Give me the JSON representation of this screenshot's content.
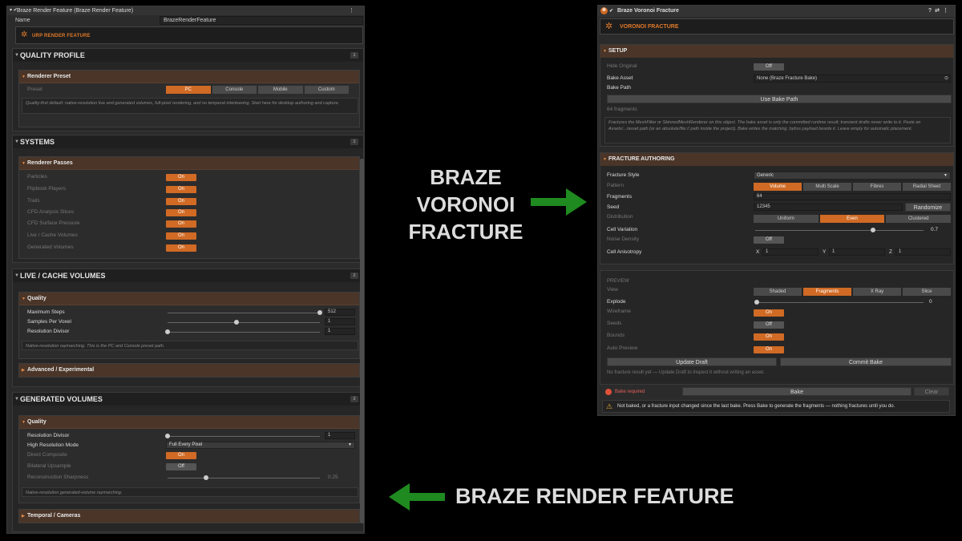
{
  "render_feature": {
    "title": "Braze Render Feature (Braze Render Feature)",
    "name_label": "Name",
    "name_value": "BrazeRenderFeature",
    "banner": "URP RENDER FEATURE",
    "quality_profile": {
      "title": "QUALITY PROFILE",
      "badge": "1",
      "renderer_preset": {
        "title": "Renderer Preset",
        "preset_label": "Preset",
        "options": [
          "PC",
          "Console",
          "Mobile",
          "Custom"
        ],
        "selected": "PC",
        "note": "Quality-first default: native-resolution live and generated volumes, full-pixel rendering, and no temporal interleaving. Start here for desktop authoring and capture."
      }
    },
    "systems": {
      "title": "SYSTEMS",
      "badge": "1",
      "renderer_passes": {
        "title": "Renderer Passes",
        "passes": [
          {
            "label": "Particles",
            "state": "On"
          },
          {
            "label": "Flipbook Players",
            "state": "On"
          },
          {
            "label": "Trails",
            "state": "On"
          },
          {
            "label": "CFD Analysis Slices",
            "state": "On"
          },
          {
            "label": "CFD Surface Pressure",
            "state": "On"
          },
          {
            "label": "Live / Cache Volumes",
            "state": "On"
          },
          {
            "label": "Generated Volumes",
            "state": "On"
          }
        ]
      }
    },
    "live_cache": {
      "title": "LIVE / CACHE VOLUMES",
      "badge": "2",
      "quality_title": "Quality",
      "max_steps_label": "Maximum Steps",
      "max_steps_value": "512",
      "max_steps_fraction": 1.0,
      "samples_label": "Samples Per Voxel",
      "samples_value": "1",
      "samples_fraction": 0.45,
      "res_div_label": "Resolution Divisor",
      "res_div_value": "1",
      "res_div_fraction": 0.0,
      "note": "Native-resolution raymarching. This is the PC and Console preset path.",
      "advanced_title": "Advanced / Experimental"
    },
    "generated": {
      "title": "GENERATED VOLUMES",
      "badge": "2",
      "quality_title": "Quality",
      "res_div_label": "Resolution Divisor",
      "res_div_value": "1",
      "res_div_fraction": 0.0,
      "high_res_label": "High Resolution Mode",
      "high_res_value": "Full Every Pixel",
      "direct_label": "Direct Composite",
      "direct_state": "On",
      "bilateral_label": "Bilateral Upsample",
      "bilateral_state": "Off",
      "sharpness_label": "Reconstruction Sharpness",
      "sharpness_value": "0.25",
      "sharpness_fraction": 0.25,
      "note": "Native-resolution generated-volume raymarching.",
      "temporal_title": "Temporal / Cameras"
    }
  },
  "voronoi": {
    "title": "Braze Voronoi Fracture",
    "banner": "VORONOI FRACTURE",
    "setup": {
      "title": "SETUP",
      "hide_original_label": "Hide Original",
      "hide_original_state": "Off",
      "bake_asset_label": "Bake Asset",
      "bake_asset_value": "None (Braze Fracture Bake)",
      "bake_path_label": "Bake Path",
      "use_bake_path": "Use Bake Path",
      "fragments_info": "64 fragments",
      "note": "Fractures the MeshFilter or SkinnedMeshRenderer on this object. The bake asset is only the committed runtime result; transient drafts never write to it. Paste an Assets/.../asset path (or an absolute/file:// path inside the project). Bake writes the matching .bybss payload beside it. Leave empty for automatic placement."
    },
    "authoring": {
      "title": "FRACTURE AUTHORING",
      "style_label": "Fracture Style",
      "style_value": "Generic",
      "pattern_label": "Pattern",
      "pattern_options": [
        "Volume",
        "Multi Scale",
        "Fibres",
        "Radial Sheet"
      ],
      "pattern_selected": "Volume",
      "fragments_label": "Fragments",
      "fragments_value": "64",
      "seed_label": "Seed",
      "seed_value": "12345",
      "randomize": "Randomize",
      "distribution_label": "Distribution",
      "distribution_options": [
        "Uniform",
        "Even",
        "Clustered"
      ],
      "distribution_selected": "Even",
      "cell_var_label": "Cell Variation",
      "cell_var_value": "0.7",
      "cell_var_fraction": 0.7,
      "noise_label": "Noise Density",
      "noise_state": "Off",
      "aniso_label": "Cell Anisotropy",
      "aniso": [
        {
          "axis": "X",
          "value": "1"
        },
        {
          "axis": "Y",
          "value": "1"
        },
        {
          "axis": "Z",
          "value": "1"
        }
      ]
    },
    "preview": {
      "title": "PREVIEW",
      "view_label": "View",
      "view_options": [
        "Shaded",
        "Fragments",
        "X Ray",
        "Slice"
      ],
      "view_selected": "Fragments",
      "explode_label": "Explode",
      "explode_value": "0",
      "explode_fraction": 0.0,
      "wireframe_label": "Wireframe",
      "wireframe_state": "On",
      "seeds_label": "Seeds",
      "seeds_state": "Off",
      "bounds_label": "Bounds",
      "bounds_state": "On",
      "auto_label": "Auto Preview",
      "auto_state": "On",
      "update_draft": "Update Draft",
      "commit_bake": "Commit Bake",
      "status": "No fracture result yet — Update Draft to inspect it without writing an asset."
    },
    "bake": {
      "required": "Bake required",
      "bake_btn": "Bake",
      "clear_btn": "Clear",
      "warning": "Not baked, or a fracture input changed since the last bake. Press Bake to generate the fragments — nothing fractures until you do."
    }
  },
  "captions": {
    "voronoi_line1": "BRAZE",
    "voronoi_line2": "VORONOI",
    "voronoi_line3": "FRACTURE",
    "render_feature": "BRAZE RENDER FEATURE"
  },
  "colors": {
    "accent": "#d06a24",
    "arrow": "#1f8a1f",
    "header_sub": "#4a3528"
  }
}
